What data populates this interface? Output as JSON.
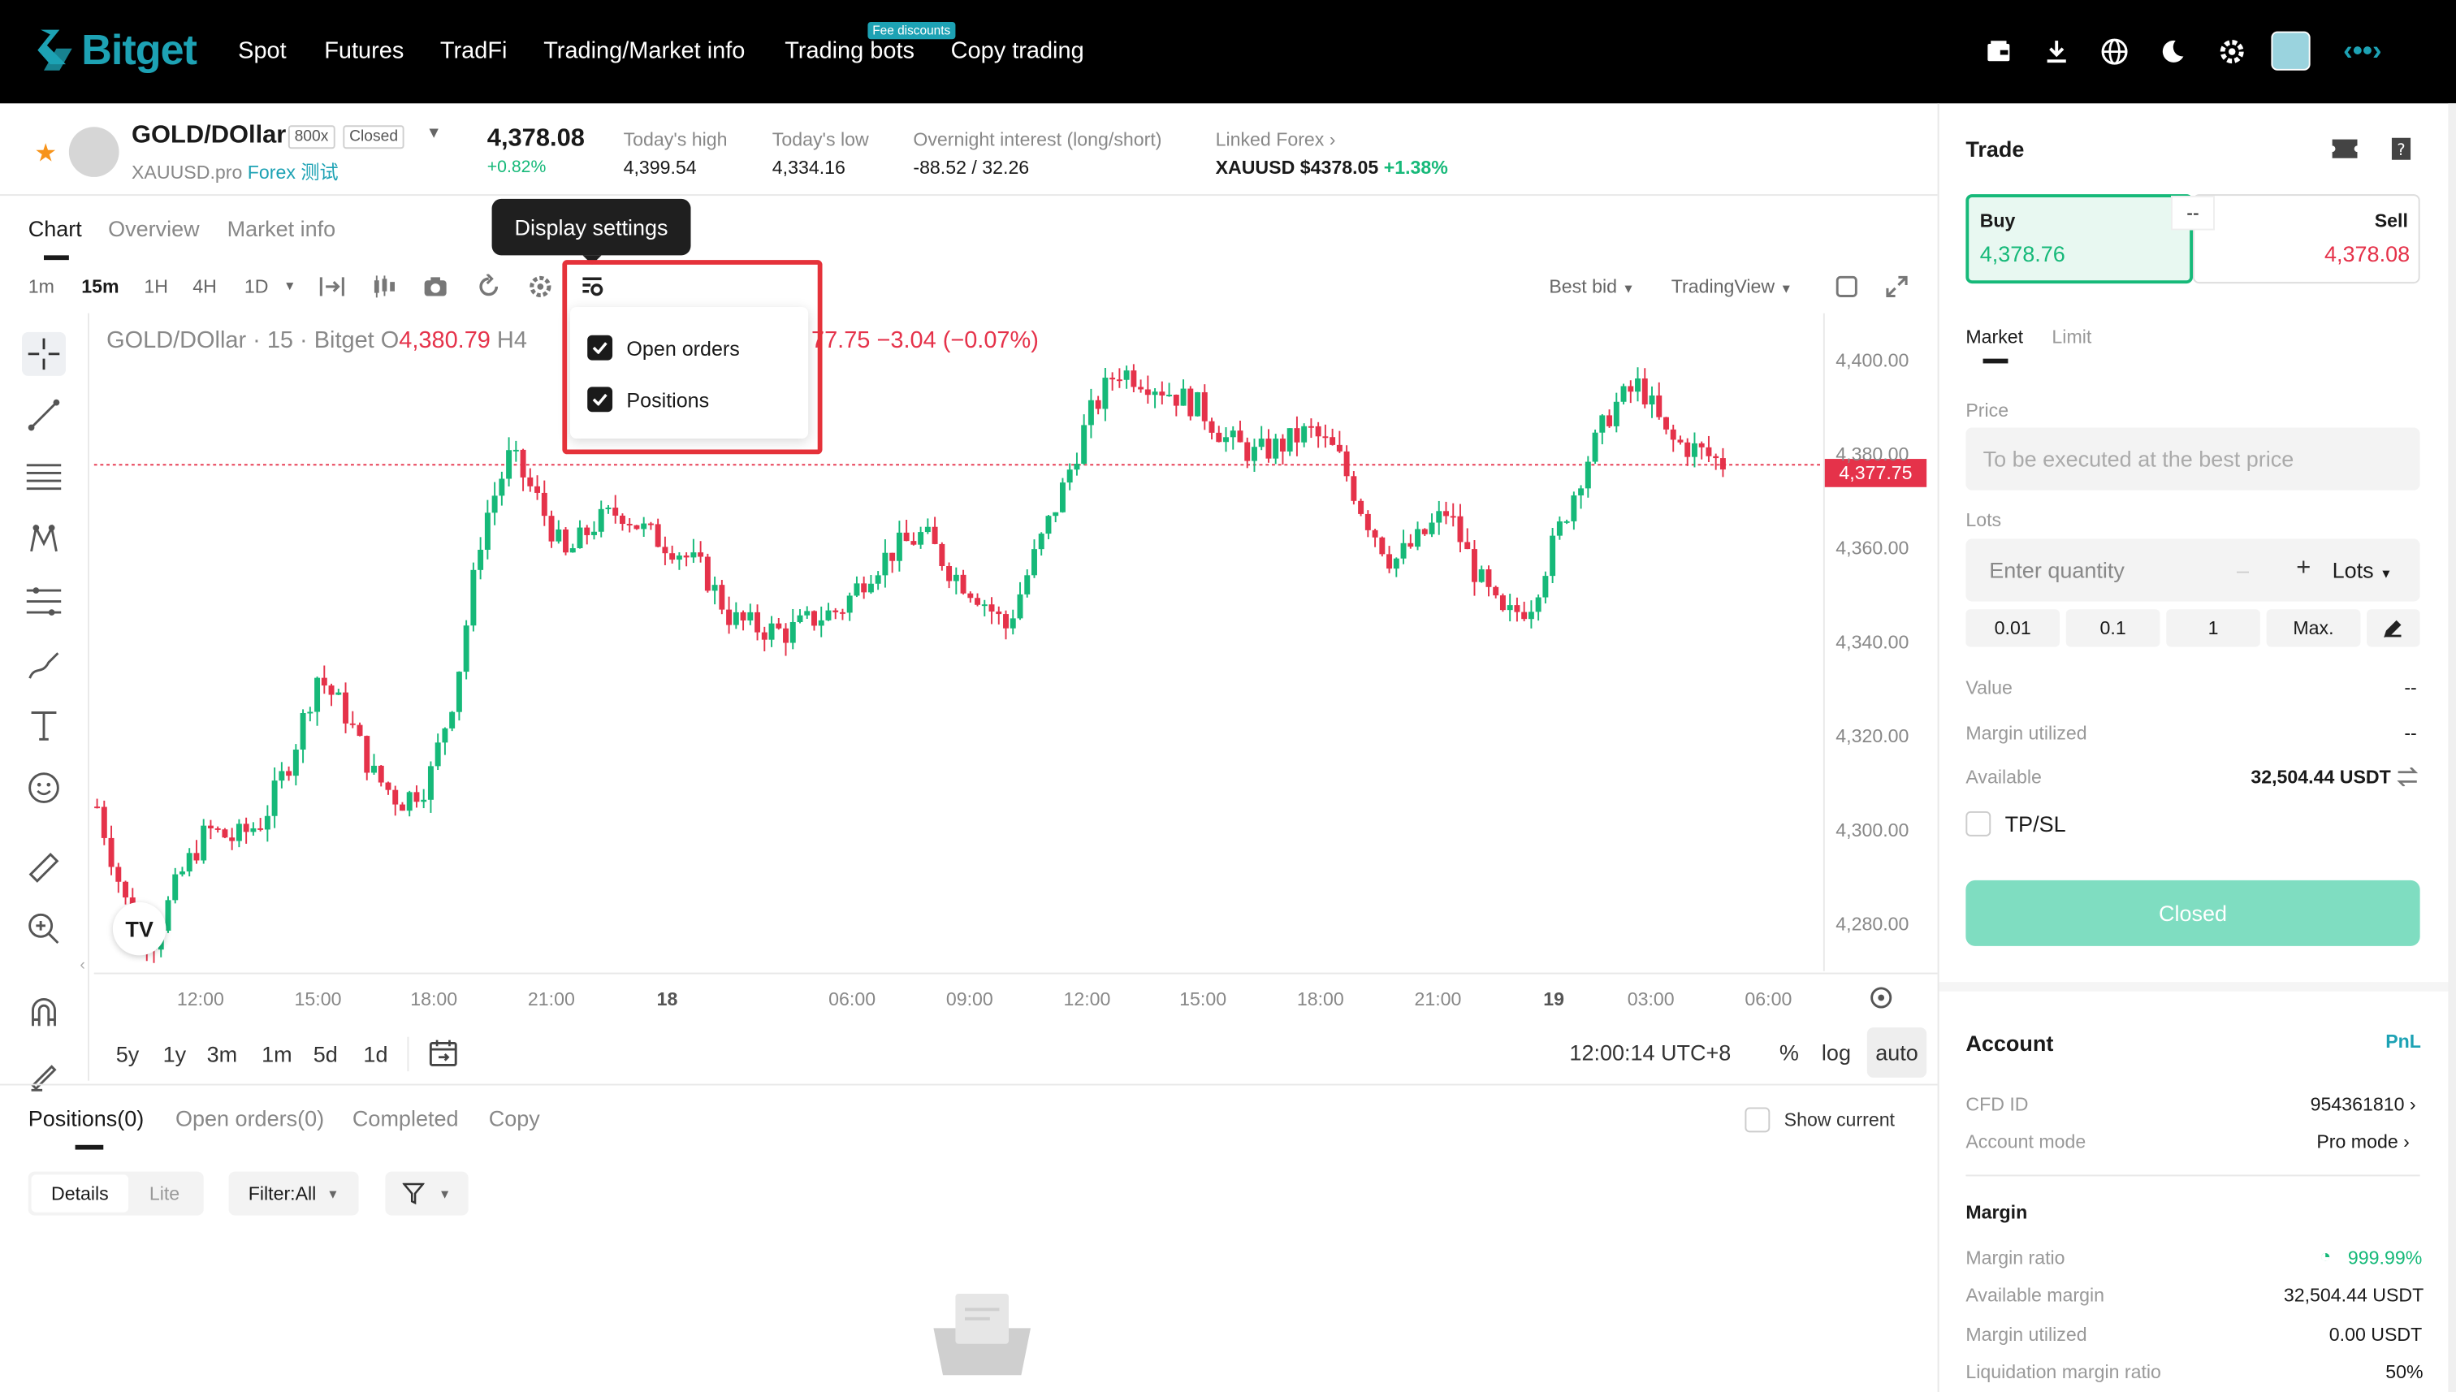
{
  "navbar": {
    "logo_text": "Bitget",
    "items": [
      "Spot",
      "Futures",
      "TradFi",
      "Trading/Market info",
      "Trading bots",
      "Copy trading"
    ],
    "fee_badge": "Fee discounts"
  },
  "symbol": {
    "name": "GOLD/DOllar",
    "leverage": "800x",
    "status": "Closed",
    "sub_code": "XAUUSD.pro",
    "sub_type": "Forex",
    "sub_tag": "测试",
    "price": "4,378.08",
    "change": "+0.82%",
    "stats": [
      {
        "label": "Today's high",
        "value": "4,399.54"
      },
      {
        "label": "Today's low",
        "value": "4,334.16"
      },
      {
        "label": "Overnight interest (long/short)",
        "value": "-88.52 / 32.26"
      },
      {
        "label": "Linked Forex",
        "value": "XAUUSD $4378.05",
        "value2": "+1.38%"
      }
    ]
  },
  "chart_tabs": [
    "Chart",
    "Overview",
    "Market info"
  ],
  "timeframes": [
    "1m",
    "15m",
    "1H",
    "4H",
    "1D"
  ],
  "toolbar_right": {
    "best_bid": "Best bid",
    "view": "TradingView"
  },
  "tooltip": "Display settings",
  "display_menu": [
    "Open orders",
    "Positions"
  ],
  "ohlc": {
    "prefix": "GOLD/DOllar · 15 · Bitget",
    "o_label": "O",
    "o_value": "4,380.79",
    "h_label": "H4",
    "tail": "77.75",
    "chg": "−3.04 (−0.07%)"
  },
  "chart_data": {
    "type": "candlestick",
    "ylim": [
      4270,
      4410
    ],
    "y_ticks": [
      "4,400.00",
      "4,380.00",
      "4,360.00",
      "4,340.00",
      "4,320.00",
      "4,300.00",
      "4,280.00"
    ],
    "x_ticks": [
      "12:00",
      "15:00",
      "18:00",
      "21:00",
      "18",
      "06:00",
      "09:00",
      "12:00",
      "15:00",
      "18:00",
      "21:00",
      "19",
      "03:00",
      "06:00"
    ],
    "last_price": "4,377.75",
    "close_path": [
      4305,
      4285,
      4276,
      4290,
      4300,
      4298,
      4302,
      4315,
      4333,
      4325,
      4312,
      4306,
      4310,
      4330,
      4365,
      4380,
      4370,
      4358,
      4365,
      4368,
      4363,
      4360,
      4355,
      4345,
      4343,
      4342,
      4345,
      4347,
      4355,
      4360,
      4363,
      4355,
      4350,
      4343,
      4358,
      4372,
      4388,
      4398,
      4396,
      4393,
      4390,
      4383,
      4380,
      4382,
      4385,
      4380,
      4367,
      4357,
      4362,
      4368,
      4355,
      4345,
      4348,
      4363,
      4378,
      4390,
      4395,
      4383,
      4381,
      4378
    ]
  },
  "range_buttons": [
    "5y",
    "1y",
    "3m",
    "1m",
    "5d",
    "1d"
  ],
  "timebar": {
    "time": "12:00:14 UTC+8",
    "pct": "%",
    "log": "log",
    "auto": "auto"
  },
  "positions_tabs": [
    "Positions(0)",
    "Open orders(0)",
    "Completed",
    "Copy"
  ],
  "show_current": "Show current",
  "view_seg": [
    "Details",
    "Lite"
  ],
  "filter": "Filter:All",
  "trade": {
    "title": "Trade",
    "buy_label": "Buy",
    "buy_price": "4,378.76",
    "sell_label": "Sell",
    "sell_price": "4,378.08",
    "mid": "--",
    "order_tabs": [
      "Market",
      "Limit"
    ],
    "price_label": "Price",
    "price_placeholder": "To be executed at the best price",
    "lots_label": "Lots",
    "qty_placeholder": "Enter quantity",
    "qty_unit": "Lots",
    "lot_buttons": [
      "0.01",
      "0.1",
      "1",
      "Max."
    ],
    "value_label": "Value",
    "value": "--",
    "margin_label": "Margin utilized",
    "margin": "--",
    "available_label": "Available",
    "available": "32,504.44 USDT",
    "tpsl": "TP/SL",
    "closed_button": "Closed"
  },
  "account": {
    "title": "Account",
    "pnl": "PnL",
    "cfd_label": "CFD ID",
    "cfd_value": "954361810",
    "mode_label": "Account mode",
    "mode_value": "Pro mode"
  },
  "margin": {
    "title": "Margin",
    "rows": [
      {
        "label": "Margin ratio",
        "value": "999.99%"
      },
      {
        "label": "Available margin",
        "value": "32,504.44 USDT"
      },
      {
        "label": "Margin utilized",
        "value": "0.00 USDT"
      },
      {
        "label": "Liquidation margin ratio",
        "value": "50%"
      }
    ]
  },
  "colors": {
    "brand": "#1da2b4",
    "up": "#16b979",
    "down": "#e5324a"
  }
}
